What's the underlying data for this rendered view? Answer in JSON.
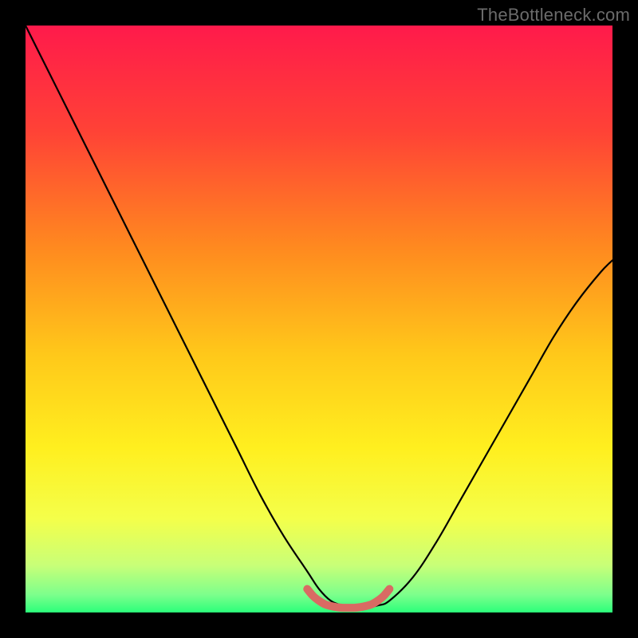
{
  "watermark": "TheBottleneck.com",
  "chart_data": {
    "type": "line",
    "title": "",
    "xlabel": "",
    "ylabel": "",
    "xlim": [
      0,
      100
    ],
    "ylim": [
      0,
      100
    ],
    "legend": false,
    "grid": false,
    "background_gradient": {
      "stops": [
        {
          "pos": 0.0,
          "color": "#ff1a4b"
        },
        {
          "pos": 0.18,
          "color": "#ff4236"
        },
        {
          "pos": 0.38,
          "color": "#ff8a1f"
        },
        {
          "pos": 0.56,
          "color": "#ffc81a"
        },
        {
          "pos": 0.72,
          "color": "#ffef1f"
        },
        {
          "pos": 0.84,
          "color": "#f4ff4a"
        },
        {
          "pos": 0.92,
          "color": "#c8ff78"
        },
        {
          "pos": 0.97,
          "color": "#7cff8c"
        },
        {
          "pos": 1.0,
          "color": "#2bff7a"
        }
      ]
    },
    "series": [
      {
        "name": "bottleneck-curve",
        "color": "#000000",
        "x": [
          0,
          4,
          8,
          12,
          16,
          20,
          24,
          28,
          32,
          36,
          40,
          44,
          48,
          50,
          52,
          54,
          56,
          58,
          60,
          62,
          66,
          70,
          74,
          78,
          82,
          86,
          90,
          94,
          98,
          100
        ],
        "y": [
          100,
          92,
          84,
          76,
          68,
          60,
          52,
          44,
          36,
          28,
          20,
          13,
          7,
          4,
          2,
          1.2,
          0.8,
          0.8,
          1.2,
          2,
          6,
          12,
          19,
          26,
          33,
          40,
          47,
          53,
          58,
          60
        ]
      },
      {
        "name": "optimal-region-marker",
        "color": "#d96a63",
        "thick": true,
        "x": [
          48,
          49,
          50,
          51,
          52,
          53,
          54,
          55,
          56,
          57,
          58,
          59,
          60,
          61,
          62
        ],
        "y": [
          4.0,
          2.8,
          2.0,
          1.4,
          1.1,
          0.9,
          0.8,
          0.8,
          0.8,
          0.9,
          1.1,
          1.4,
          2.0,
          2.8,
          4.0
        ]
      }
    ]
  }
}
